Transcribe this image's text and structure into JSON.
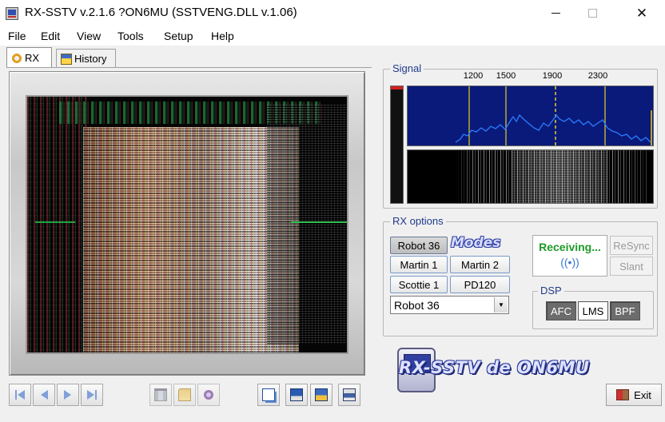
{
  "window": {
    "title": "RX-SSTV v.2.1.6 ?ON6MU (SSTVENG.DLL v.1.06)",
    "minimize_icon": "minimize-icon",
    "maximize_icon": "maximize-icon",
    "close_icon": "close-icon"
  },
  "menu": [
    "File",
    "Edit",
    "View",
    "Tools",
    "Setup",
    "Help"
  ],
  "tabs": {
    "rx": "RX",
    "history": "History"
  },
  "signal": {
    "label": "Signal",
    "freq_markers": [
      "1200",
      "1500",
      "1900",
      "2300"
    ]
  },
  "rx_options": {
    "label": "RX options",
    "modes_logo": "Modes",
    "mode_buttons": [
      "Robot 36",
      "Martin 1",
      "Martin 2",
      "Scottie 1",
      "PD120"
    ],
    "active_mode": "Robot 36",
    "selected_mode": "Robot 36",
    "status": "Receiving...",
    "resync": "ReSync",
    "slant": "Slant",
    "dsp": {
      "label": "DSP",
      "afc": "AFC",
      "lms": "LMS",
      "bpf": "BPF"
    }
  },
  "logo_text": "RX-SSTV de ON6MU",
  "exit": "Exit",
  "colors": {
    "group_label": "#1f3a8a",
    "status_green": "#1d9a2a",
    "spectrum_bg": "#0a1a7a",
    "spectrum_trace": "#2a7cff",
    "marker_yellow": "#e8d020"
  }
}
